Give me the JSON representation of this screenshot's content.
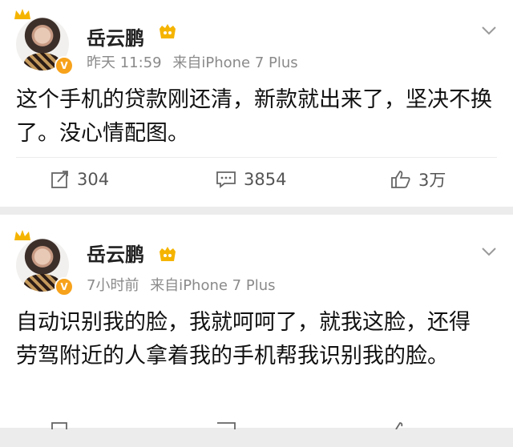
{
  "posts": [
    {
      "username": "岳云鹏",
      "time": "昨天 11:59",
      "source": "来自iPhone 7 Plus",
      "content": "这个手机的贷款刚还清，新款就出来了，坚决不换了。没心情配图。",
      "actions": {
        "repost": "304",
        "comment": "3854",
        "like": "3万"
      }
    },
    {
      "username": "岳云鹏",
      "time": "7小时前",
      "source": "来自iPhone 7 Plus",
      "content": "自动识别我的脸，我就呵呵了，就我这脸，还得劳驾附近的人拿着我的手机帮我识别我的脸。"
    }
  ],
  "colors": {
    "accent": "#f7a21b",
    "meta": "#8a8a8a",
    "background": "#ececec"
  }
}
